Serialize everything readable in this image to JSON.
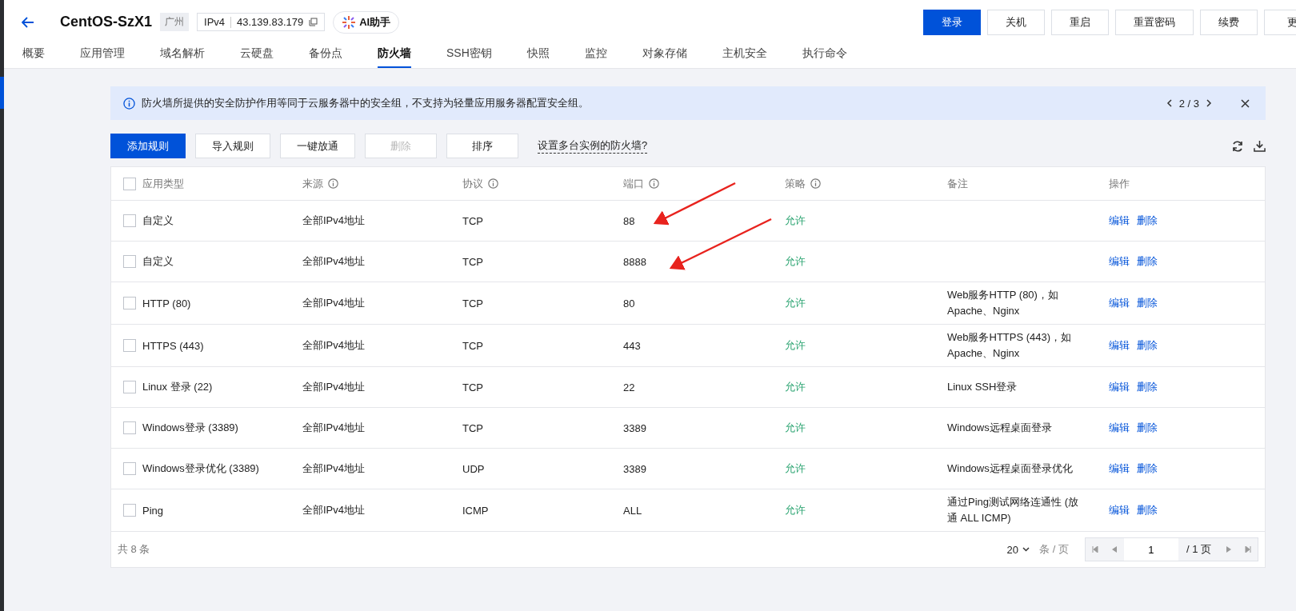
{
  "header": {
    "title": "CentOS-SzX1",
    "region": "广州",
    "ip_label": "IPv4",
    "ip": "43.139.83.179",
    "ai_button": "AI助手",
    "actions": [
      {
        "label": "登录",
        "primary": true
      },
      {
        "label": "关机",
        "primary": false
      },
      {
        "label": "重启",
        "primary": false
      },
      {
        "label": "重置密码",
        "primary": false
      },
      {
        "label": "续费",
        "primary": false
      },
      {
        "label": "更",
        "primary": false
      }
    ]
  },
  "tabs": [
    {
      "label": "概要",
      "selected": false
    },
    {
      "label": "应用管理",
      "selected": false
    },
    {
      "label": "域名解析",
      "selected": false
    },
    {
      "label": "云硬盘",
      "selected": false
    },
    {
      "label": "备份点",
      "selected": false
    },
    {
      "label": "防火墙",
      "selected": true
    },
    {
      "label": "SSH密钥",
      "selected": false
    },
    {
      "label": "快照",
      "selected": false
    },
    {
      "label": "监控",
      "selected": false
    },
    {
      "label": "对象存储",
      "selected": false
    },
    {
      "label": "主机安全",
      "selected": false
    },
    {
      "label": "执行命令",
      "selected": false
    }
  ],
  "notice": {
    "text": "防火墙所提供的安全防护作用等同于云服务器中的安全组，不支持为轻量应用服务器配置安全组。",
    "pager": "2 / 3"
  },
  "toolbar": {
    "buttons": [
      {
        "label": "添加规则",
        "primary": true,
        "disabled": false
      },
      {
        "label": "导入规则",
        "primary": false,
        "disabled": false
      },
      {
        "label": "一键放通",
        "primary": false,
        "disabled": false
      },
      {
        "label": "删除",
        "primary": false,
        "disabled": true
      },
      {
        "label": "排序",
        "primary": false,
        "disabled": false
      }
    ],
    "help_link": "设置多台实例的防火墙?"
  },
  "table": {
    "header_checked": false,
    "columns": [
      {
        "label": "应用类型",
        "info": false
      },
      {
        "label": "来源",
        "info": true
      },
      {
        "label": "协议",
        "info": true
      },
      {
        "label": "端口",
        "info": true
      },
      {
        "label": "策略",
        "info": true
      },
      {
        "label": "备注",
        "info": false
      },
      {
        "label": "操作",
        "info": false
      }
    ],
    "rows": [
      {
        "checked": false,
        "type": "自定义",
        "source": "全部IPv4地址",
        "protocol": "TCP",
        "port": "88",
        "policy": "允许",
        "note": "",
        "edit": "编辑",
        "delete": "删除"
      },
      {
        "checked": false,
        "type": "自定义",
        "source": "全部IPv4地址",
        "protocol": "TCP",
        "port": "8888",
        "policy": "允许",
        "note": "",
        "edit": "编辑",
        "delete": "删除"
      },
      {
        "checked": false,
        "type": "HTTP (80)",
        "source": "全部IPv4地址",
        "protocol": "TCP",
        "port": "80",
        "policy": "允许",
        "note": "Web服务HTTP (80)，如 Apache、Nginx",
        "edit": "编辑",
        "delete": "删除"
      },
      {
        "checked": false,
        "type": "HTTPS (443)",
        "source": "全部IPv4地址",
        "protocol": "TCP",
        "port": "443",
        "policy": "允许",
        "note": "Web服务HTTPS (443)，如 Apache、Nginx",
        "edit": "编辑",
        "delete": "删除"
      },
      {
        "checked": false,
        "type": "Linux 登录 (22)",
        "source": "全部IPv4地址",
        "protocol": "TCP",
        "port": "22",
        "policy": "允许",
        "note": "Linux SSH登录",
        "edit": "编辑",
        "delete": "删除"
      },
      {
        "checked": false,
        "type": "Windows登录 (3389)",
        "source": "全部IPv4地址",
        "protocol": "TCP",
        "port": "3389",
        "policy": "允许",
        "note": "Windows远程桌面登录",
        "edit": "编辑",
        "delete": "删除"
      },
      {
        "checked": false,
        "type": "Windows登录优化 (3389)",
        "source": "全部IPv4地址",
        "protocol": "UDP",
        "port": "3389",
        "policy": "允许",
        "note": "Windows远程桌面登录优化",
        "edit": "编辑",
        "delete": "删除"
      },
      {
        "checked": false,
        "type": "Ping",
        "source": "全部IPv4地址",
        "protocol": "ICMP",
        "port": "ALL",
        "policy": "允许",
        "note": "通过Ping测试网络连通性 (放通 ALL ICMP)",
        "edit": "编辑",
        "delete": "删除"
      }
    ]
  },
  "footer": {
    "total": "共 8 条",
    "page_size": "20",
    "page_size_unit": "条 / 页",
    "page": "1",
    "page_total": "/ 1 页"
  }
}
